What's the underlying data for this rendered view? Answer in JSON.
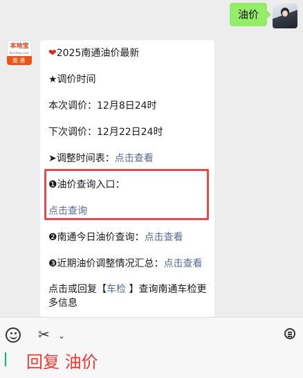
{
  "outgoing": {
    "text": "油价"
  },
  "bot_avatar": {
    "logo_text": "本地宝",
    "small_text": "Bendibao.com",
    "city": "南通"
  },
  "message": {
    "heart_icon": "❤",
    "title": "2025南通油价最新",
    "adjust_header": "★调价时间",
    "this_adjust": "本次调价：12月8日24时",
    "next_adjust": "下次调价：12月22日24时",
    "schedule_prefix": "➤调整时间表：",
    "schedule_link": "点击查看",
    "query_entry_label": "❶油价查询入口：",
    "query_link": "点击查询",
    "today_prefix": "❷南通今日油价查询：",
    "today_link": "点击查看",
    "recent_prefix": "❸近期油价调整情况汇总：",
    "recent_link": "点击查看",
    "reply_prefix": "点击或回复【",
    "reply_keyword": "车检",
    "reply_suffix": " 】查询南通车检更多信息"
  },
  "input_bar": {
    "typed_text": "回复 油价",
    "icons": [
      "emoji-icon",
      "scissors-icon",
      "chevron-down-icon",
      "history-icon"
    ]
  },
  "colors": {
    "bubble_me": "#95ec69",
    "link": "#576b95",
    "highlight": "#e8474c",
    "typed": "#f43530",
    "cursor": "#07c160"
  }
}
